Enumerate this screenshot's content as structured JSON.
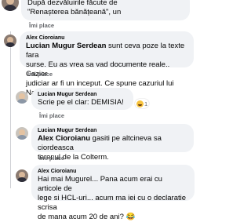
{
  "colors": {
    "bubble_bg": "#f0f2f5",
    "action_text": "#65676b",
    "text": "#050505"
  },
  "top_comment": {
    "text_line1": "După dezvăluirile făcute de",
    "text_line2": "\"Renașterea bănățeană\", un",
    "action": "Îmi place",
    "reply": "Răspunde"
  },
  "comments": [
    {
      "author": "Alex Cioroianu",
      "mention": "Lucian Mugur Serdean",
      "text_line1_rest": " sunt ceva poze la texte fara",
      "text_line2": "surse. Eu as vrea sa vad documente reale.. Cazier",
      "text_line3": "judiciar ar fi un inceput. Ce spune cazuriul lui Nanu?",
      "action": "Îmi place",
      "reply": "Răspunde"
    },
    {
      "author": "Lucian Mugur Serdean",
      "text_line1": "Scrie pe el clar: DEMISIA!",
      "reaction_count": "1",
      "action": "Îmi place",
      "reply": "Răspunde"
    },
    {
      "author": "Lucian Mugur Serdean",
      "mention": "Alex Cioroianu",
      "text_line1_rest": " gasiti pe altcineva sa ciordeasca",
      "text_line2": "terenul de la Colterm.",
      "action": "Îmi place",
      "reply": "Răspunde"
    },
    {
      "author": "Alex Cioroianu",
      "text_line1": "Hai mai Mugurel... Pana acum erai cu articole de",
      "text_line2": "lege si HCL-uri... acum ma iei cu o declaratie scrisa",
      "text_line3": "de mana acum 20 de ani? 😂"
    }
  ]
}
